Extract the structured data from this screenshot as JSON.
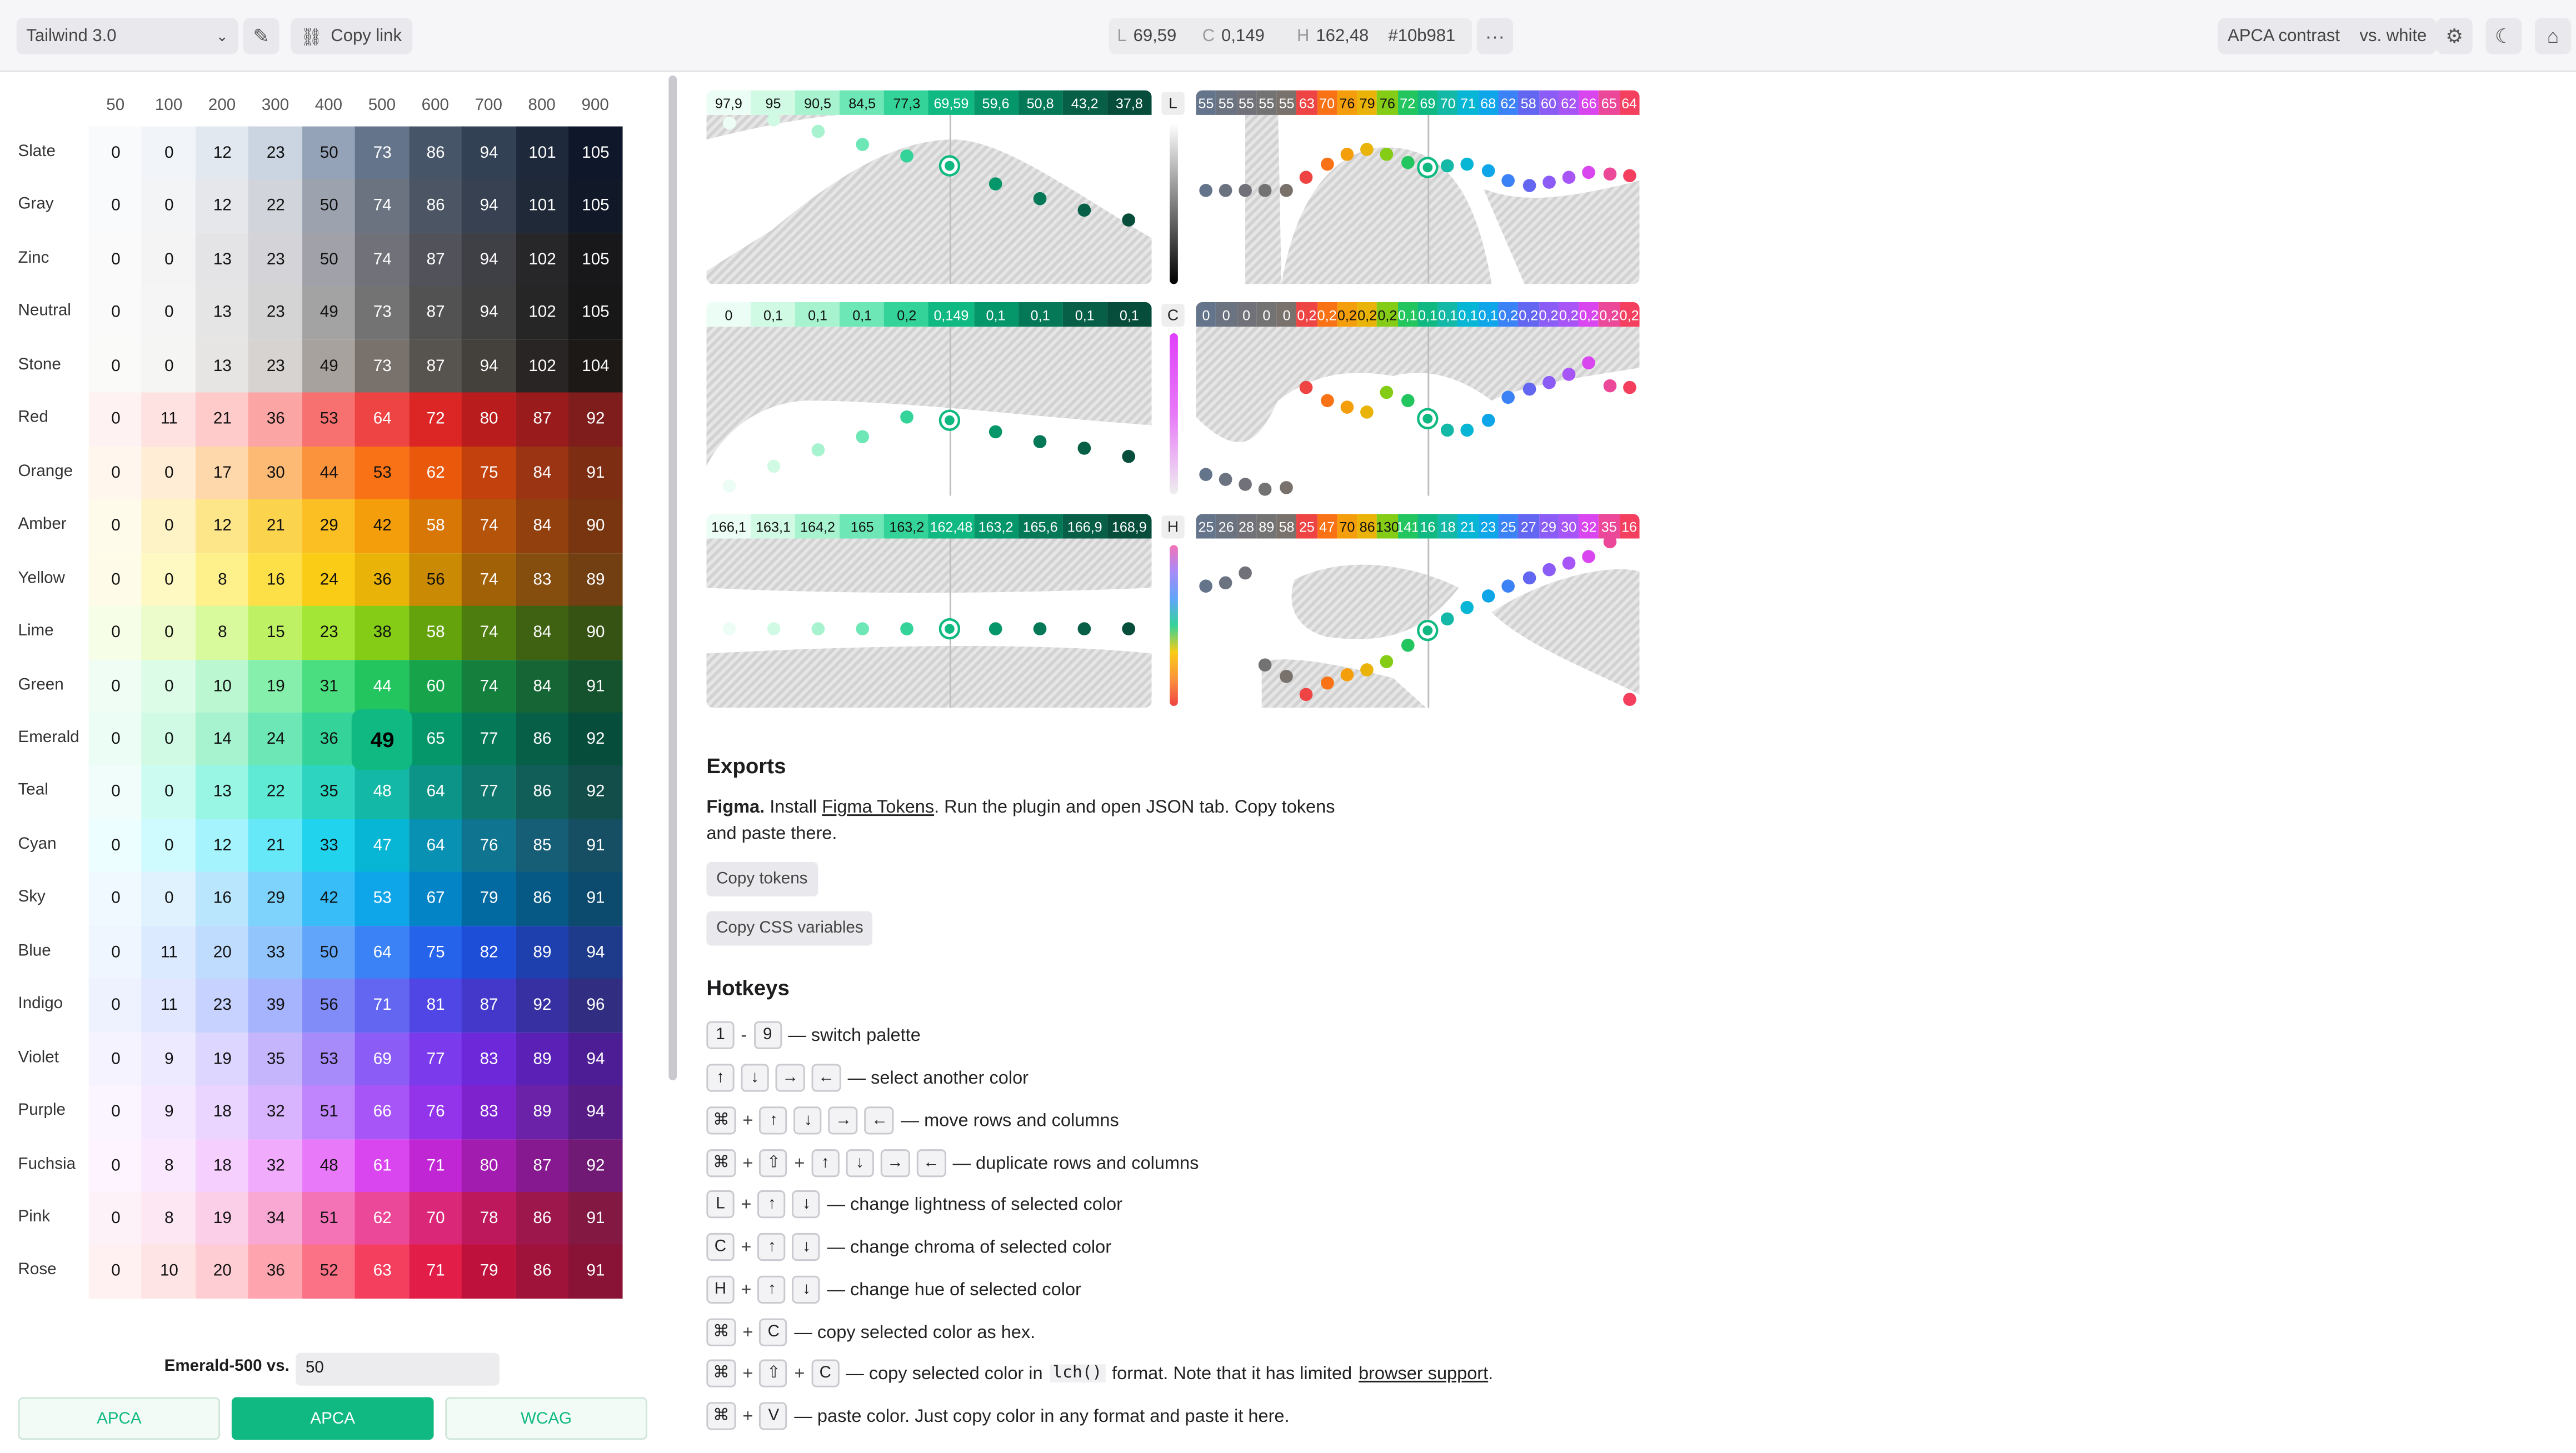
{
  "topbar": {
    "palette_select": "Tailwind 3.0",
    "copy_link": "Copy link",
    "l_label": "L",
    "l_value": "69,59",
    "c_label": "C",
    "c_value": "0,149",
    "h_label": "H",
    "h_value": "162,48",
    "hex": "#10b981",
    "contrast_mode": "APCA contrast",
    "contrast_vs": "vs. white"
  },
  "grid": {
    "columns": [
      "50",
      "100",
      "200",
      "300",
      "400",
      "500",
      "600",
      "700",
      "800",
      "900"
    ],
    "rows": [
      {
        "name": "Slate",
        "values": [
          "0",
          "0",
          "12",
          "23",
          "50",
          "73",
          "86",
          "94",
          "101",
          "105"
        ],
        "colors": [
          "#f8fafc",
          "#f1f5f9",
          "#e2e8f0",
          "#cbd5e1",
          "#94a3b8",
          "#64748b",
          "#475569",
          "#334155",
          "#1e293b",
          "#0f172a"
        ]
      },
      {
        "name": "Gray",
        "values": [
          "0",
          "0",
          "12",
          "22",
          "50",
          "74",
          "86",
          "94",
          "101",
          "105"
        ],
        "colors": [
          "#f9fafb",
          "#f3f4f6",
          "#e5e7eb",
          "#d1d5db",
          "#9ca3af",
          "#6b7280",
          "#4b5563",
          "#374151",
          "#1f2937",
          "#111827"
        ]
      },
      {
        "name": "Zinc",
        "values": [
          "0",
          "0",
          "13",
          "23",
          "50",
          "74",
          "87",
          "94",
          "102",
          "105"
        ],
        "colors": [
          "#fafafa",
          "#f4f4f5",
          "#e4e4e7",
          "#d4d4d8",
          "#a1a1aa",
          "#71717a",
          "#52525b",
          "#3f3f46",
          "#27272a",
          "#18181b"
        ]
      },
      {
        "name": "Neutral",
        "values": [
          "0",
          "0",
          "13",
          "23",
          "49",
          "73",
          "87",
          "94",
          "102",
          "105"
        ],
        "colors": [
          "#fafafa",
          "#f5f5f5",
          "#e5e5e5",
          "#d4d4d4",
          "#a3a3a3",
          "#737373",
          "#525252",
          "#404040",
          "#262626",
          "#171717"
        ]
      },
      {
        "name": "Stone",
        "values": [
          "0",
          "0",
          "13",
          "23",
          "49",
          "73",
          "87",
          "94",
          "102",
          "104"
        ],
        "colors": [
          "#fafaf9",
          "#f5f5f4",
          "#e7e5e4",
          "#d6d3d1",
          "#a8a29e",
          "#78716c",
          "#57534e",
          "#44403c",
          "#292524",
          "#1c1917"
        ]
      },
      {
        "name": "Red",
        "values": [
          "0",
          "11",
          "21",
          "36",
          "53",
          "64",
          "72",
          "80",
          "87",
          "92"
        ],
        "colors": [
          "#fef2f2",
          "#fee2e2",
          "#fecaca",
          "#fca5a5",
          "#f87171",
          "#ef4444",
          "#dc2626",
          "#b91c1c",
          "#991b1b",
          "#7f1d1d"
        ]
      },
      {
        "name": "Orange",
        "values": [
          "0",
          "0",
          "17",
          "30",
          "44",
          "53",
          "62",
          "75",
          "84",
          "91"
        ],
        "colors": [
          "#fff7ed",
          "#ffedd5",
          "#fed7aa",
          "#fdba74",
          "#fb923c",
          "#f97316",
          "#ea580c",
          "#c2410c",
          "#9a3412",
          "#7c2d12"
        ]
      },
      {
        "name": "Amber",
        "values": [
          "0",
          "0",
          "12",
          "21",
          "29",
          "42",
          "58",
          "74",
          "84",
          "90"
        ],
        "colors": [
          "#fffbeb",
          "#fef3c7",
          "#fde68a",
          "#fcd34d",
          "#fbbf24",
          "#f59e0b",
          "#d97706",
          "#b45309",
          "#92400e",
          "#78350f"
        ]
      },
      {
        "name": "Yellow",
        "values": [
          "0",
          "0",
          "8",
          "16",
          "24",
          "36",
          "56",
          "74",
          "83",
          "89"
        ],
        "colors": [
          "#fefce8",
          "#fef9c3",
          "#fef08a",
          "#fde047",
          "#facc15",
          "#eab308",
          "#ca8a04",
          "#a16207",
          "#854d0e",
          "#713f12"
        ]
      },
      {
        "name": "Lime",
        "values": [
          "0",
          "0",
          "8",
          "15",
          "23",
          "38",
          "58",
          "74",
          "84",
          "90"
        ],
        "colors": [
          "#f7fee7",
          "#ecfccb",
          "#d9f99d",
          "#bef264",
          "#a3e635",
          "#84cc16",
          "#65a30d",
          "#4d7c0f",
          "#3f6212",
          "#365314"
        ]
      },
      {
        "name": "Green",
        "values": [
          "0",
          "0",
          "10",
          "19",
          "31",
          "44",
          "60",
          "74",
          "84",
          "91"
        ],
        "colors": [
          "#f0fdf4",
          "#dcfce7",
          "#bbf7d0",
          "#86efac",
          "#4ade80",
          "#22c55e",
          "#16a34a",
          "#15803d",
          "#166534",
          "#14532d"
        ]
      },
      {
        "name": "Emerald",
        "values": [
          "0",
          "0",
          "14",
          "24",
          "36",
          "49",
          "65",
          "77",
          "86",
          "92"
        ],
        "colors": [
          "#ecfdf5",
          "#d1fae5",
          "#a7f3d0",
          "#6ee7b7",
          "#34d399",
          "#10b981",
          "#059669",
          "#047857",
          "#065f46",
          "#064e3b"
        ]
      },
      {
        "name": "Teal",
        "values": [
          "0",
          "0",
          "13",
          "22",
          "35",
          "48",
          "64",
          "77",
          "86",
          "92"
        ],
        "colors": [
          "#f0fdfa",
          "#ccfbf1",
          "#99f6e4",
          "#5eead4",
          "#2dd4bf",
          "#14b8a6",
          "#0d9488",
          "#0f766e",
          "#115e59",
          "#134e4a"
        ]
      },
      {
        "name": "Cyan",
        "values": [
          "0",
          "0",
          "12",
          "21",
          "33",
          "47",
          "64",
          "76",
          "85",
          "91"
        ],
        "colors": [
          "#ecfeff",
          "#cffafe",
          "#a5f3fc",
          "#67e8f9",
          "#22d3ee",
          "#06b6d4",
          "#0891b2",
          "#0e7490",
          "#155e75",
          "#164e63"
        ]
      },
      {
        "name": "Sky",
        "values": [
          "0",
          "0",
          "16",
          "29",
          "42",
          "53",
          "67",
          "79",
          "86",
          "91"
        ],
        "colors": [
          "#f0f9ff",
          "#e0f2fe",
          "#bae6fd",
          "#7dd3fc",
          "#38bdf8",
          "#0ea5e9",
          "#0284c7",
          "#0369a1",
          "#075985",
          "#0c4a6e"
        ]
      },
      {
        "name": "Blue",
        "values": [
          "0",
          "11",
          "20",
          "33",
          "50",
          "64",
          "75",
          "82",
          "89",
          "94"
        ],
        "colors": [
          "#eff6ff",
          "#dbeafe",
          "#bfdbfe",
          "#93c5fd",
          "#60a5fa",
          "#3b82f6",
          "#2563eb",
          "#1d4ed8",
          "#1e40af",
          "#1e3a8a"
        ]
      },
      {
        "name": "Indigo",
        "values": [
          "0",
          "11",
          "23",
          "39",
          "56",
          "71",
          "81",
          "87",
          "92",
          "96"
        ],
        "colors": [
          "#eef2ff",
          "#e0e7ff",
          "#c7d2fe",
          "#a5b4fc",
          "#818cf8",
          "#6366f1",
          "#4f46e5",
          "#4338ca",
          "#3730a3",
          "#312e81"
        ]
      },
      {
        "name": "Violet",
        "values": [
          "0",
          "9",
          "19",
          "35",
          "53",
          "69",
          "77",
          "83",
          "89",
          "94"
        ],
        "colors": [
          "#f5f3ff",
          "#ede9fe",
          "#ddd6fe",
          "#c4b5fd",
          "#a78bfa",
          "#8b5cf6",
          "#7c3aed",
          "#6d28d9",
          "#5b21b6",
          "#4c1d95"
        ]
      },
      {
        "name": "Purple",
        "values": [
          "0",
          "9",
          "18",
          "32",
          "51",
          "66",
          "76",
          "83",
          "89",
          "94"
        ],
        "colors": [
          "#faf5ff",
          "#f3e8ff",
          "#e9d5ff",
          "#d8b4fe",
          "#c084fc",
          "#a855f7",
          "#9333ea",
          "#7e22ce",
          "#6b21a8",
          "#581c87"
        ]
      },
      {
        "name": "Fuchsia",
        "values": [
          "0",
          "8",
          "18",
          "32",
          "48",
          "61",
          "71",
          "80",
          "87",
          "92"
        ],
        "colors": [
          "#fdf4ff",
          "#fae8ff",
          "#f5d0fe",
          "#f0abfc",
          "#e879f9",
          "#d946ef",
          "#c026d3",
          "#a21caf",
          "#86198f",
          "#701a75"
        ]
      },
      {
        "name": "Pink",
        "values": [
          "0",
          "8",
          "19",
          "34",
          "51",
          "62",
          "70",
          "78",
          "86",
          "91"
        ],
        "colors": [
          "#fdf2f8",
          "#fce7f3",
          "#fbcfe8",
          "#f9a8d4",
          "#f472b6",
          "#ec4899",
          "#db2777",
          "#be185d",
          "#9d174d",
          "#831843"
        ]
      },
      {
        "name": "Rose",
        "values": [
          "0",
          "10",
          "20",
          "36",
          "52",
          "63",
          "71",
          "79",
          "86",
          "91"
        ],
        "colors": [
          "#fff1f2",
          "#ffe4e6",
          "#fecdd3",
          "#fda4af",
          "#fb7185",
          "#f43f5e",
          "#e11d48",
          "#be123c",
          "#9f1239",
          "#881337"
        ]
      }
    ],
    "selected": {
      "row": 11,
      "col": 5
    }
  },
  "compare": {
    "label": "Emerald-500 vs.",
    "value": "50"
  },
  "tabs": [
    "APCA",
    "APCA",
    "WCAG"
  ],
  "charts": {
    "l_axis": "L",
    "c_axis": "C",
    "h_axis": "H",
    "l_strip_left": [
      "97,9",
      "95",
      "90,5",
      "84,5",
      "77,3",
      "69,59",
      "59,6",
      "50,8",
      "43,2",
      "37,8"
    ],
    "c_strip_left": [
      "0",
      "0,1",
      "0,1",
      "0,1",
      "0,2",
      "0,149",
      "0,1",
      "0,1",
      "0,1",
      "0,1"
    ],
    "h_strip_left": [
      "166,1",
      "163,1",
      "164,2",
      "165",
      "163,2",
      "162,48",
      "163,2",
      "165,6",
      "166,9",
      "168,9"
    ],
    "l_strip_right": [
      "55",
      "55",
      "55",
      "55",
      "55",
      "63",
      "70",
      "76",
      "79",
      "76",
      "72",
      "69",
      "70",
      "71",
      "68",
      "62",
      "58",
      "60",
      "62",
      "66",
      "65",
      "64"
    ],
    "c_strip_right": [
      "0",
      "0",
      "0",
      "0",
      "0",
      "0,2",
      "0,2",
      "0,2",
      "0,2",
      "0,2",
      "0,1",
      "0,1",
      "0,1",
      "0,1",
      "0,1",
      "0,2",
      "0,2",
      "0,2",
      "0,2",
      "0,2",
      "0,2",
      "0,2"
    ],
    "h_strip_right": [
      "25",
      "26",
      "28",
      "89",
      "58",
      "25",
      "47",
      "70",
      "86",
      "130",
      "141",
      "16",
      "18",
      "21",
      "23",
      "25",
      "27",
      "29",
      "30",
      "32",
      "35",
      "16"
    ]
  },
  "exports": {
    "title": "Exports",
    "figma_bold": "Figma.",
    "figma_text1": " Install ",
    "figma_link": "Figma Tokens",
    "figma_text2": ". Run the plugin and open JSON tab. Copy tokens and paste there.",
    "copy_tokens": "Copy tokens",
    "copy_css": "Copy CSS variables"
  },
  "hotkeys": {
    "title": "Hotkeys",
    "items": [
      {
        "keys": [
          "1",
          "-",
          "9"
        ],
        "text": "— switch palette"
      },
      {
        "keys": [
          "↑",
          "↓",
          "→",
          "←"
        ],
        "text": "— select another color"
      },
      {
        "keys": [
          "⌘",
          "+",
          "↑",
          "↓",
          "→",
          "←"
        ],
        "text": "— move rows and columns"
      },
      {
        "keys": [
          "⌘",
          "+",
          "⇧",
          "+",
          "↑",
          "↓",
          "→",
          "←"
        ],
        "text": "— duplicate rows and columns"
      },
      {
        "keys": [
          "L",
          "+",
          "↑",
          "↓"
        ],
        "text": "— change lightness of selected color"
      },
      {
        "keys": [
          "C",
          "+",
          "↑",
          "↓"
        ],
        "text": "— change chroma of selected color"
      },
      {
        "keys": [
          "H",
          "+",
          "↑",
          "↓"
        ],
        "text": "— change hue of selected color"
      },
      {
        "keys": [
          "⌘",
          "+",
          "C"
        ],
        "text": "— copy selected color as hex."
      },
      {
        "keys": [
          "⌘",
          "+",
          "⇧",
          "+",
          "C"
        ],
        "text": "— copy selected color in",
        "code": "lch()",
        "text2": "format. Note that it has limited",
        "link": "browser support",
        "text3": "."
      },
      {
        "keys": [
          "⌘",
          "+",
          "V"
        ],
        "text": "— paste color. Just copy color in any format and paste it here."
      }
    ]
  },
  "colors": {
    "accent": "#10b981",
    "selected_dot": "#10b981"
  }
}
